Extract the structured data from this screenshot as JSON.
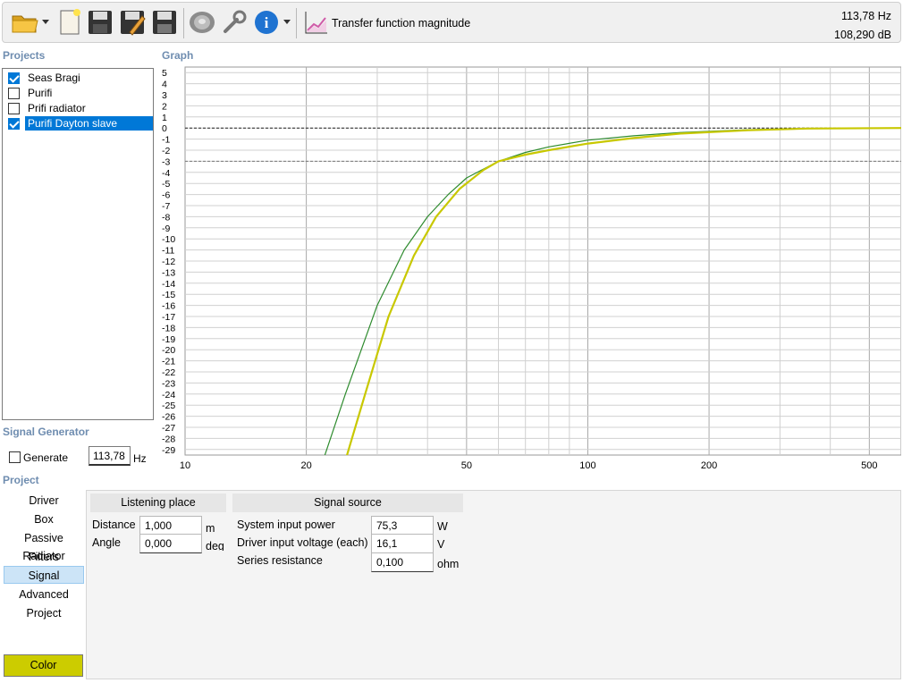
{
  "toolbar": {
    "buttons": [
      "open-folder-icon",
      "new-file-icon",
      "save-icon",
      "save-as-icon",
      "save-all-icon",
      "driver-icon",
      "settings-icon",
      "info-icon"
    ],
    "graph_selector_label": "Transfer function magnitude",
    "readout_freq": "113,78 Hz",
    "readout_db": "108,290 dB"
  },
  "projects": {
    "title": "Projects",
    "items": [
      {
        "label": "Seas Bragi",
        "checked": true
      },
      {
        "label": "Purifi",
        "checked": false
      },
      {
        "label": "Prifi radiator",
        "checked": false
      },
      {
        "label": "Purifi Dayton slave",
        "checked": true
      }
    ]
  },
  "graph": {
    "title": "Graph"
  },
  "signal_generator": {
    "title": "Signal Generator",
    "generate_label": "Generate",
    "frequency_value": "113,78",
    "frequency_unit": "Hz"
  },
  "project_nav": {
    "title": "Project",
    "items": [
      "Driver",
      "Box",
      "Passive Radiator",
      "Filters",
      "Signal",
      "Advanced",
      "Project"
    ],
    "active": "Signal",
    "color_button_label": "Color",
    "color_value": "#cccc00"
  },
  "signal_panel": {
    "listening_place": {
      "title": "Listening place",
      "distance_label": "Distance",
      "distance_value": "1,000",
      "distance_unit": "m",
      "angle_label": "Angle",
      "angle_value": "0,000",
      "angle_unit": "deg"
    },
    "signal_source": {
      "title": "Signal source",
      "power_label": "System input power",
      "power_value": "75,3",
      "power_unit": "W",
      "voltage_label": "Driver input voltage (each)",
      "voltage_value": "16,1",
      "voltage_unit": "V",
      "resistance_label": "Series resistance",
      "resistance_value": "0,100",
      "resistance_unit": "ohm"
    }
  },
  "chart_data": {
    "type": "line",
    "x_scale": "log",
    "xlim": [
      10,
      600
    ],
    "ylim": [
      -29.5,
      5.5
    ],
    "x_ticks": [
      10,
      20,
      50,
      100,
      200,
      500
    ],
    "y_ticks": [
      5,
      4,
      3,
      2,
      1,
      0,
      -1,
      -2,
      -3,
      -4,
      -5,
      -6,
      -7,
      -8,
      -9,
      -10,
      -11,
      -12,
      -13,
      -14,
      -15,
      -16,
      -17,
      -18,
      -19,
      -20,
      -21,
      -22,
      -23,
      -24,
      -25,
      -26,
      -27,
      -28,
      -29
    ],
    "reference_lines": [
      0,
      -3
    ],
    "grid": true,
    "series": [
      {
        "color": "#2e8b2e",
        "x": [
          22,
          25,
          30,
          35,
          40,
          45,
          50,
          60,
          70,
          80,
          100,
          130,
          170,
          250,
          350,
          600
        ],
        "y": [
          -30,
          -24,
          -16,
          -11,
          -8,
          -6,
          -4.5,
          -3.0,
          -2.2,
          -1.7,
          -1.1,
          -0.7,
          -0.4,
          -0.15,
          -0.05,
          0
        ]
      },
      {
        "color": "#c8c800",
        "x": [
          25,
          28,
          32,
          37,
          42,
          48,
          55,
          60,
          70,
          80,
          100,
          130,
          170,
          250,
          350,
          600
        ],
        "y": [
          -30,
          -24,
          -17,
          -11.5,
          -8,
          -5.5,
          -3.8,
          -3.0,
          -2.4,
          -2.0,
          -1.4,
          -0.9,
          -0.5,
          -0.2,
          -0.05,
          0
        ]
      }
    ]
  }
}
